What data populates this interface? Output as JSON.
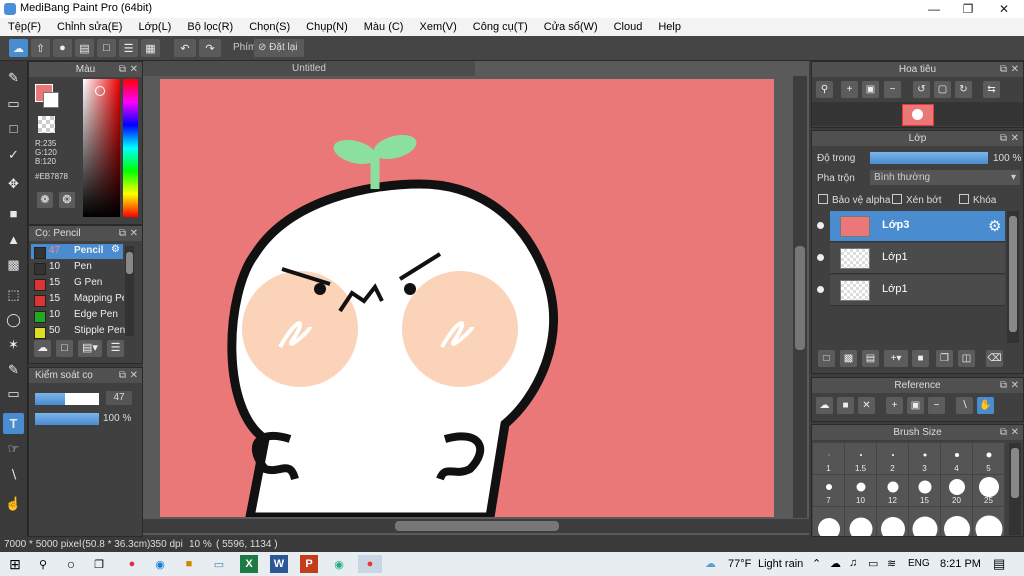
{
  "window": {
    "title": "MediBang Paint Pro (64bit)"
  },
  "menu": [
    "Tệp(F)",
    "Chỉnh sửa(E)",
    "Lớp(L)",
    "Bộ lọc(R)",
    "Chọn(S)",
    "Chụp(N)",
    "Màu (C)",
    "Xem(V)",
    "Công cụ(T)",
    "Cửa sổ(W)",
    "Cloud",
    "Help"
  ],
  "toolbar": {
    "shortcut_label": "Phím",
    "reset_label": "Đặt lại"
  },
  "color_panel": {
    "title": "Màu",
    "r": "R:235",
    "g": "G:120",
    "b": "B:120",
    "hex": "#EB7878",
    "current_color": "#eb7878"
  },
  "brush_panel": {
    "title": "Cọ: Pencil",
    "items": [
      {
        "size": "47",
        "name": "Pencil",
        "color": "#333333"
      },
      {
        "size": "10",
        "name": "Pen",
        "color": "#333333"
      },
      {
        "size": "15",
        "name": "G Pen",
        "color": "#d33"
      },
      {
        "size": "15",
        "name": "Mapping Pe",
        "color": "#d33"
      },
      {
        "size": "10",
        "name": "Edge Pen",
        "color": "#2a2"
      },
      {
        "size": "50",
        "name": "Stipple Pen",
        "color": "#dd2"
      }
    ]
  },
  "brush_control": {
    "title": "Kiểm soát cọ",
    "size": "47",
    "opacity": "100 %",
    "size_fraction": 0.47,
    "opacity_fraction": 1.0
  },
  "document": {
    "tab": "Untitled",
    "canvas_color": "#eb7878"
  },
  "navigator": {
    "title": "Hoa tiêu"
  },
  "layer_panel": {
    "title": "Lớp",
    "opacity_label": "Độ trong",
    "opacity_value": "100 %",
    "opacity_fraction": 1.0,
    "blend_label": "Pha trộn",
    "blend_value": "Bình thường",
    "protect_alpha": "Bảo vệ alpha",
    "clipping": "Xén bớt",
    "lock": "Khóa",
    "layers": [
      {
        "name": "Lớp3",
        "selected": true
      },
      {
        "name": "Lớp1",
        "selected": false
      },
      {
        "name": "Lớp1",
        "selected": false
      }
    ]
  },
  "reference_panel": {
    "title": "Reference"
  },
  "brush_size_panel": {
    "title": "Brush Size",
    "sizes": [
      "1",
      "1.5",
      "2",
      "3",
      "4",
      "5",
      "7",
      "10",
      "12",
      "15",
      "20",
      "25"
    ]
  },
  "status": {
    "dimensions": "7000 * 5000 pixel",
    "physical": "(50.8 * 36.3cm)",
    "dpi": "350 dpi",
    "zoom": "10 %",
    "coords": "( 5596, 1134 )"
  },
  "taskbar": {
    "weather_temp": "77°F",
    "weather_desc": "Light rain",
    "language": "ENG",
    "time": "8:21 PM"
  }
}
